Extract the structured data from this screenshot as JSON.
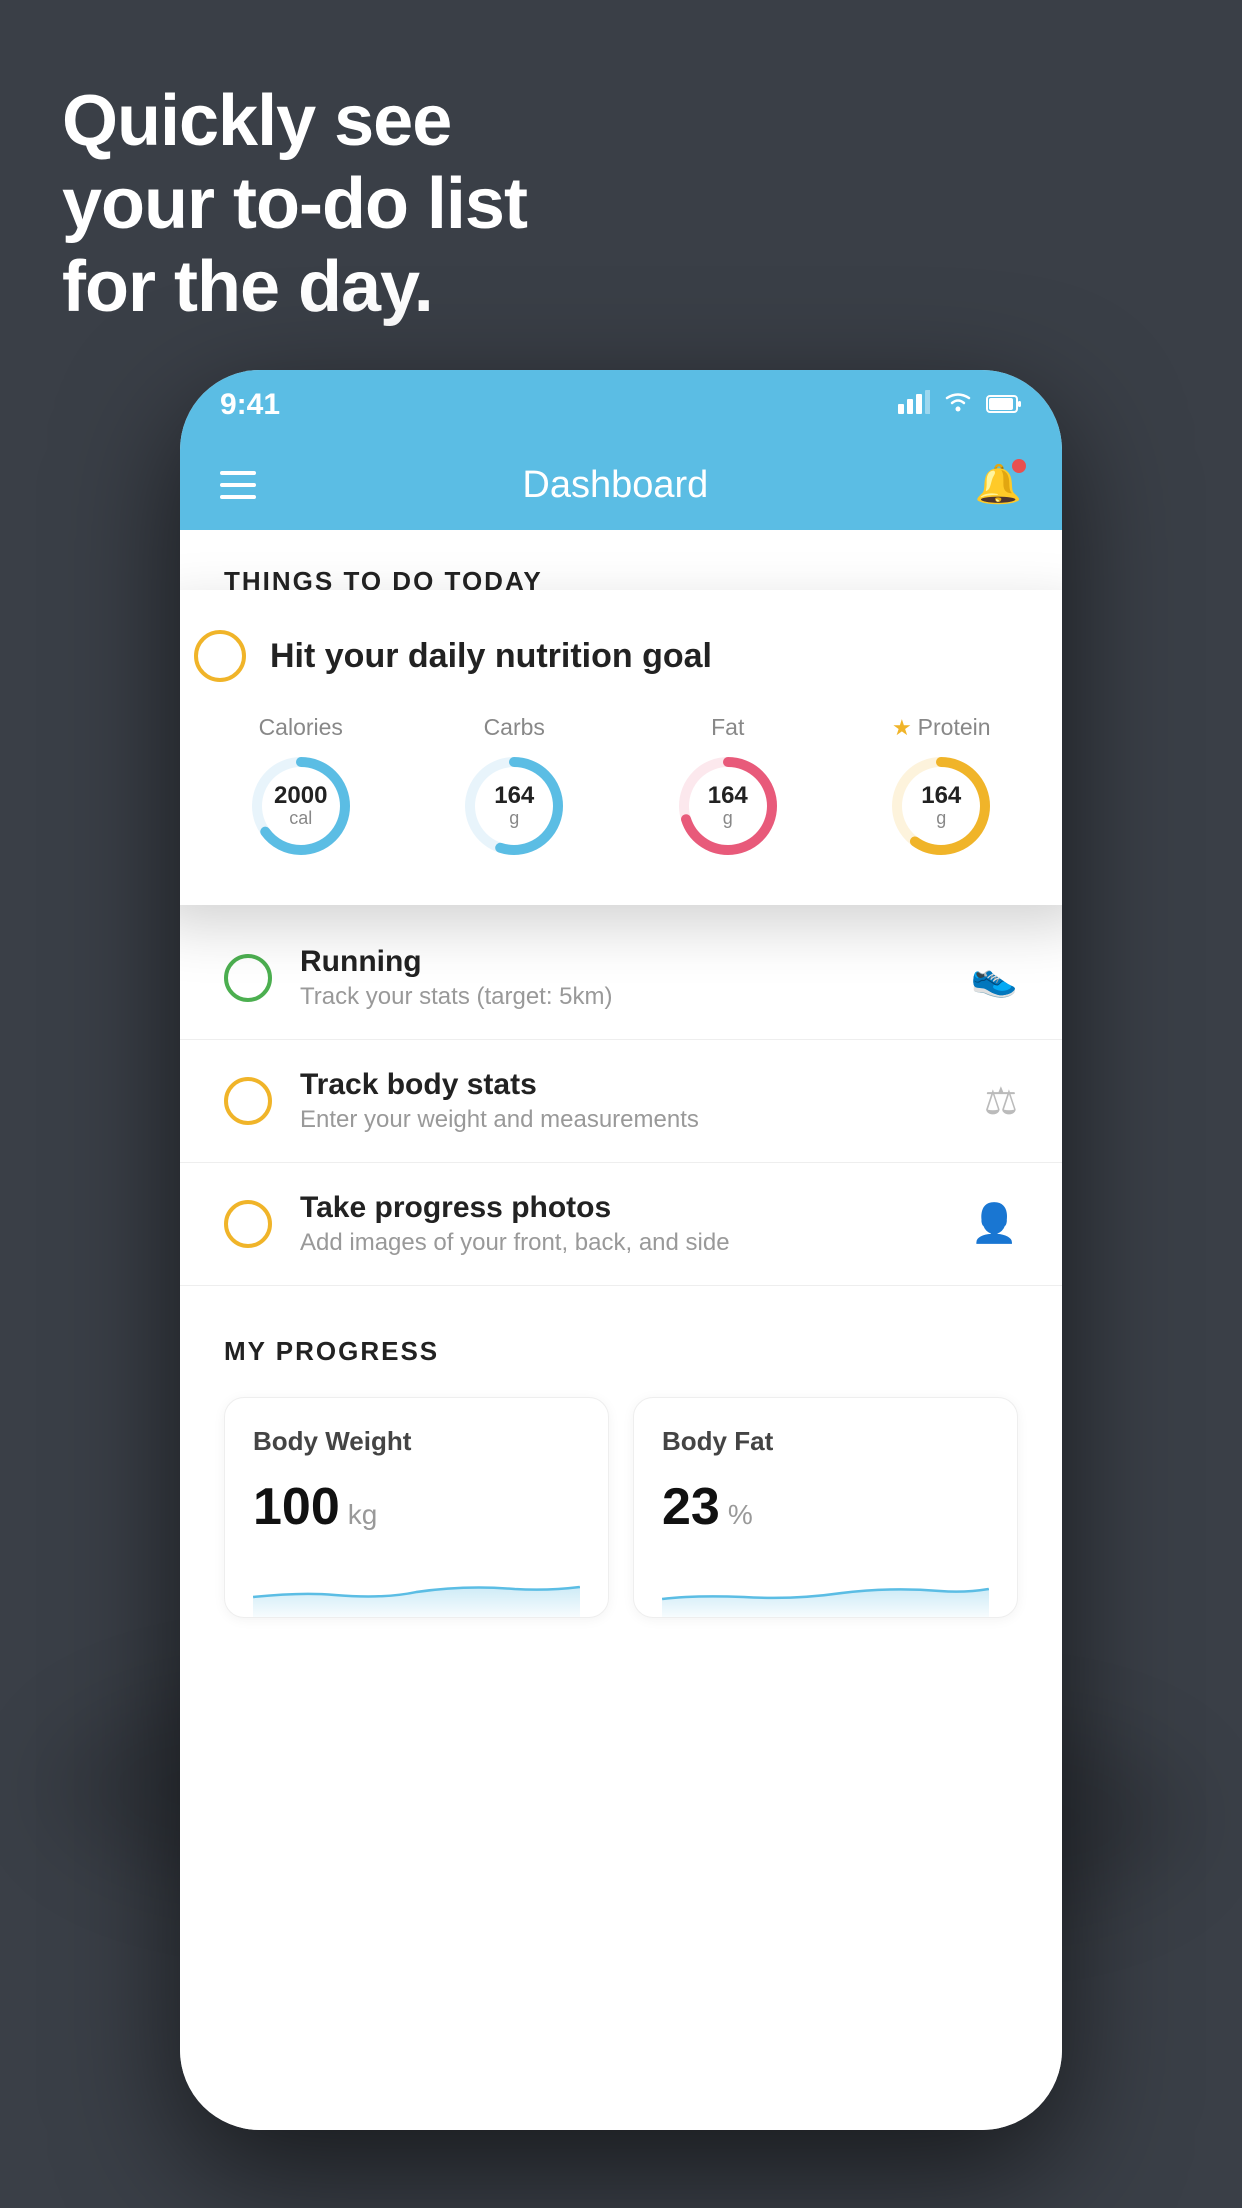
{
  "headline": {
    "line1": "Quickly see",
    "line2": "your to-do list",
    "line3": "for the day."
  },
  "status_bar": {
    "time": "9:41",
    "signal": "▋▋▋▋",
    "wifi": "wifi",
    "battery": "battery"
  },
  "nav": {
    "title": "Dashboard"
  },
  "things_today": {
    "header": "THINGS TO DO TODAY"
  },
  "nutrition_card": {
    "title": "Hit your daily nutrition goal",
    "items": [
      {
        "label": "Calories",
        "value": "2000",
        "unit": "cal",
        "color": "#5bbde4",
        "percent": 65,
        "starred": false
      },
      {
        "label": "Carbs",
        "value": "164",
        "unit": "g",
        "color": "#5bbde4",
        "percent": 55,
        "starred": false
      },
      {
        "label": "Fat",
        "value": "164",
        "unit": "g",
        "color": "#e85a7a",
        "percent": 70,
        "starred": false
      },
      {
        "label": "Protein",
        "value": "164",
        "unit": "g",
        "color": "#f0b429",
        "percent": 60,
        "starred": true
      }
    ]
  },
  "todo_items": [
    {
      "title": "Running",
      "subtitle": "Track your stats (target: 5km)",
      "check_color": "green",
      "icon": "👟"
    },
    {
      "title": "Track body stats",
      "subtitle": "Enter your weight and measurements",
      "check_color": "yellow",
      "icon": "⚖️"
    },
    {
      "title": "Take progress photos",
      "subtitle": "Add images of your front, back, and side",
      "check_color": "yellow",
      "icon": "👤"
    }
  ],
  "progress": {
    "header": "MY PROGRESS",
    "cards": [
      {
        "title": "Body Weight",
        "value": "100",
        "unit": "kg"
      },
      {
        "title": "Body Fat",
        "value": "23",
        "unit": "%"
      }
    ]
  }
}
